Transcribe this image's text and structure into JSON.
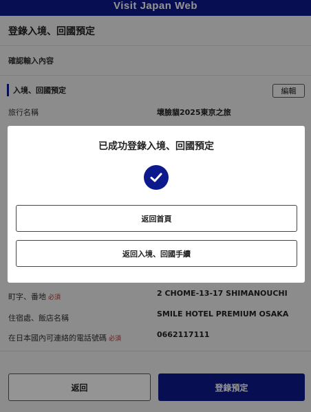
{
  "header": {
    "title": "Visit Japan Web"
  },
  "page": {
    "title": "登錄入境、回國預定",
    "subtitle": "確認輸入內容"
  },
  "section": {
    "title": "入境、回國預定",
    "edit_label": "編輯"
  },
  "rows": [
    {
      "label": "旅行名稱",
      "required": "",
      "value": "壞臉貓2025東京之旅"
    },
    {
      "label": "町字、番地",
      "required": "必須",
      "value": "2 CHOME-13-17 SHIMANOUCHI"
    },
    {
      "label": "住宿處、飯店名稱",
      "required": "",
      "value": "SMILE HOTEL PREMIUM OSAKA"
    },
    {
      "label": "在日本國內可連絡的電話號碼",
      "required": "必須",
      "value": "0662117111"
    }
  ],
  "footer": {
    "back_label": "返回",
    "register_label": "登錄預定"
  },
  "modal": {
    "title": "已成功登錄入境、回國預定",
    "home_label": "返回首頁",
    "procedures_label": "返回入境、回國手續"
  },
  "colors": {
    "brand": "#0d1a8e",
    "required": "#c62828"
  },
  "icons": {
    "success": "check-circle-icon"
  }
}
